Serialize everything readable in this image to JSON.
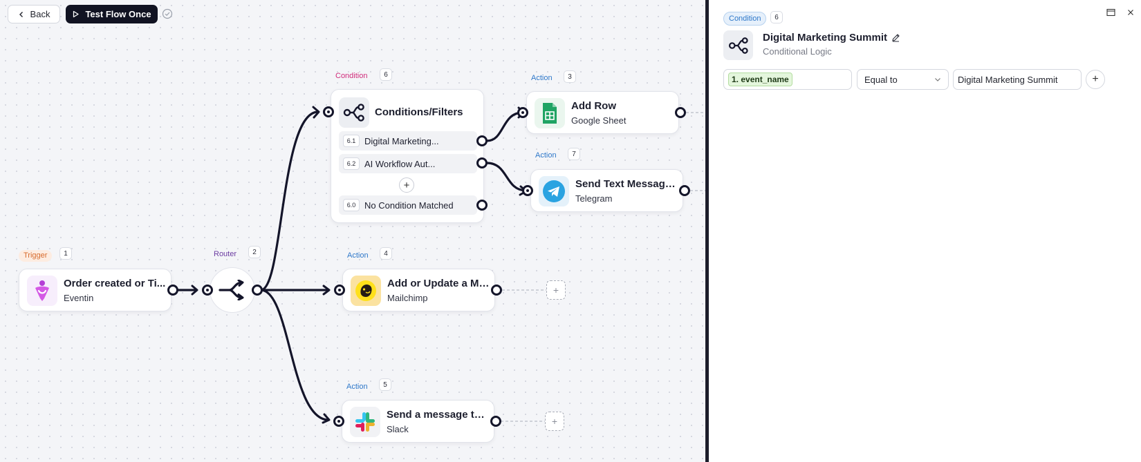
{
  "toolbar": {
    "back_label": "Back",
    "test_label": "Test Flow Once"
  },
  "nodes": {
    "trigger": {
      "tag": "Trigger",
      "num": "1",
      "title": "Order created or Ti...",
      "sub": "Eventin"
    },
    "router": {
      "tag": "Router",
      "num": "2"
    },
    "condition": {
      "tag": "Condition",
      "num": "6",
      "title": "Conditions/Filters",
      "rows": [
        {
          "badge": "6.1",
          "label": "Digital Marketing..."
        },
        {
          "badge": "6.2",
          "label": "AI Workflow Aut..."
        },
        {
          "badge": "6.0",
          "label": "No Condition Matched"
        }
      ],
      "add": "+"
    },
    "action3": {
      "tag": "Action",
      "num": "3",
      "title": "Add Row",
      "sub": "Google Sheet"
    },
    "action7": {
      "tag": "Action",
      "num": "7",
      "title": "Send Text Message ...",
      "sub": "Telegram"
    },
    "action4": {
      "tag": "Action",
      "num": "4",
      "title": "Add or Update a Me...",
      "sub": "Mailchimp"
    },
    "action5": {
      "tag": "Action",
      "num": "5",
      "title": "Send a message to a...",
      "sub": "Slack"
    },
    "add_symbol": "+"
  },
  "panel": {
    "pill": "Condition",
    "num": "6",
    "title": "Digital Marketing Summit",
    "subtitle": "Conditional Logic",
    "condition": {
      "field_token": "1. event_name",
      "operator": "Equal to",
      "value": "Digital Marketing Summit"
    },
    "add_symbol": "+"
  },
  "icons": {
    "back": "chevron-left-icon",
    "play": "play-icon",
    "check": "check-circle-icon",
    "router": "router-icon",
    "conditions": "share-nodes-icon",
    "edit": "pencil-icon",
    "google_sheet": "google-sheets-icon",
    "telegram": "telegram-icon",
    "mailchimp": "mailchimp-icon",
    "slack": "slack-icon",
    "eventin": "eventin-icon",
    "window": "window-icon",
    "close": "close-icon",
    "chevron_down": "chevron-down-icon"
  },
  "colors": {
    "edge": "#14152a",
    "test_button": "#111322",
    "trigger_tag": "#d76a2c",
    "condition_tag": "#d02b7a",
    "action_tag": "#2d77c9",
    "router_tag": "#6a3aa0"
  }
}
